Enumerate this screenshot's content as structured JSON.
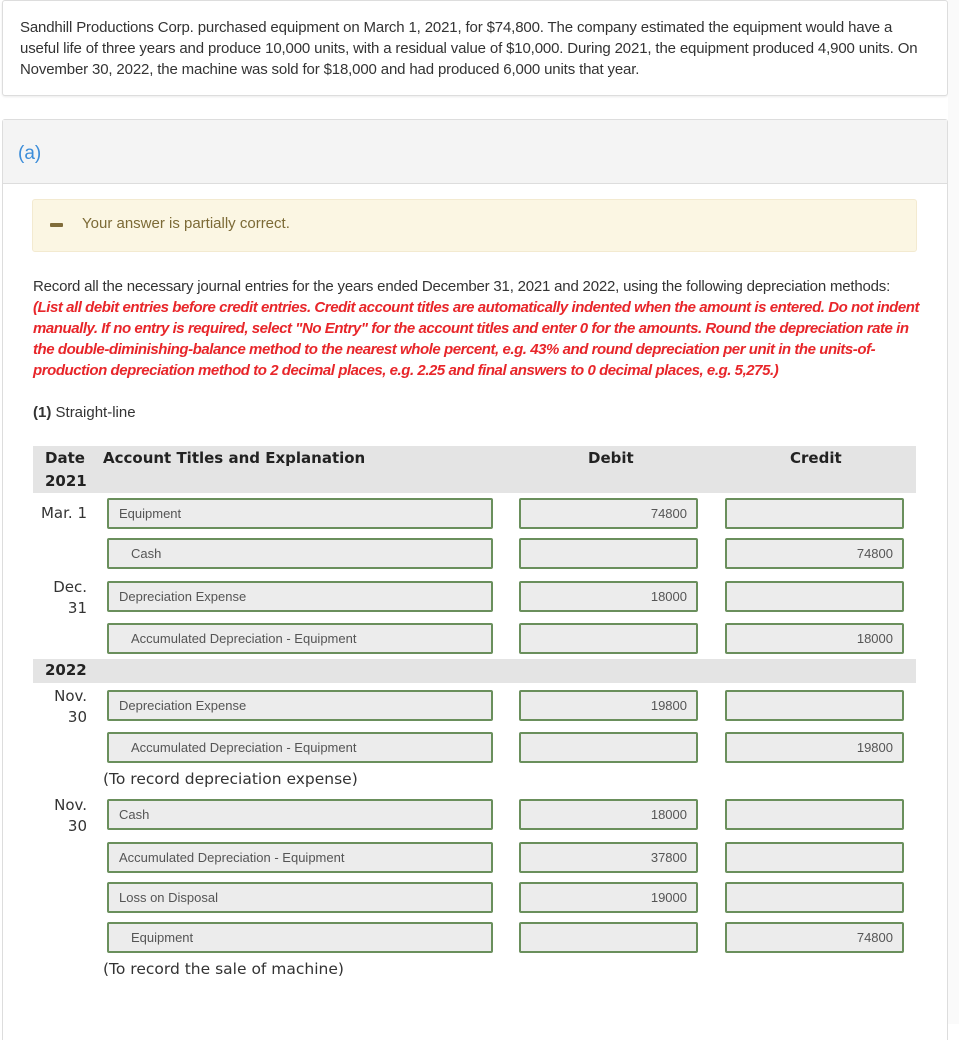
{
  "problem": {
    "text": "Sandhill Productions Corp. purchased equipment on March 1, 2021, for $74,800. The company estimated the equipment would have a useful life of three years and produce 10,000 units, with a residual value of $10,000. During 2021, the equipment produced 4,900 units. On November 30, 2022, the machine was sold for $18,000 and had produced 6,000 units that year."
  },
  "part": {
    "label": "(a)",
    "accent_color": "#3c8dd9"
  },
  "alert": {
    "icon": "minus-icon",
    "text": "Your answer is partially correct."
  },
  "instructions": {
    "intro": "Record all the necessary journal entries for the years ended December 31, 2021 and 2022, using the following depreciation methods: ",
    "emphasis": "(List all debit entries before credit entries. Credit account titles are automatically indented when the amount is entered. Do not indent manually. If no entry is required, select \"No Entry\" for the account titles and enter 0 for the amounts. Round the depreciation rate in the double-diminishing-balance method to the nearest whole percent, e.g. 43% and round depreciation per unit in the units-of-production depreciation method to 2 decimal places, e.g. 2.25 and final answers to 0 decimal places, e.g. 5,275.)",
    "emphasis_color": "#e8262a"
  },
  "method": {
    "number": "(1)",
    "name": "Straight-line"
  },
  "table": {
    "headers": {
      "date": "Date",
      "account": "Account Titles and Explanation",
      "debit": "Debit",
      "credit": "Credit"
    },
    "years": [
      "2021",
      "2022"
    ],
    "rows": [
      {
        "date": "Mar. 1",
        "account": "Equipment",
        "debit": "74800",
        "credit": ""
      },
      {
        "date": "",
        "account": "Cash",
        "debit": "",
        "credit": "74800"
      },
      {
        "date": "Dec.\n31",
        "date_month": "Dec.",
        "date_day": "31",
        "account": "Depreciation Expense",
        "debit": "18000",
        "credit": ""
      },
      {
        "date": "",
        "account": "Accumulated Depreciation - Equipment",
        "debit": "",
        "credit": "18000"
      },
      {
        "date": "Nov.\n30",
        "date_month": "Nov.",
        "date_day": "30",
        "account": "Depreciation Expense",
        "debit": "19800",
        "credit": ""
      },
      {
        "date": "",
        "account": "Accumulated Depreciation - Equipment",
        "debit": "",
        "credit": "19800"
      },
      {
        "date": "Nov.\n30",
        "date_month": "Nov.",
        "date_day": "30",
        "account": "Cash",
        "debit": "18000",
        "credit": ""
      },
      {
        "date": "",
        "account": "Accumulated Depreciation - Equipment",
        "debit": "37800",
        "credit": ""
      },
      {
        "date": "",
        "account": "Loss on Disposal",
        "debit": "19000",
        "credit": ""
      },
      {
        "date": "",
        "account": "Equipment",
        "debit": "",
        "credit": "74800"
      }
    ],
    "notes": [
      "(To record depreciation expense)",
      "(To record the sale of machine)"
    ],
    "field_border_color": "#6a8f5c"
  }
}
